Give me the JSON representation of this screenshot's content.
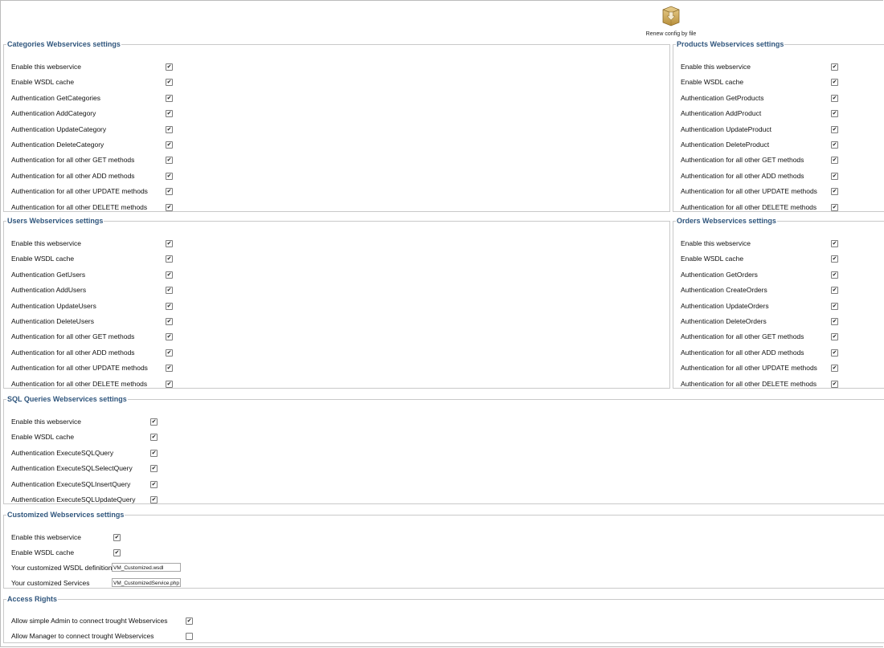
{
  "toolbar": {
    "renew_label": "Renew config by file",
    "renew_icon": "package-down-icon"
  },
  "categories": {
    "title": "Categories Webservices settings",
    "rows": [
      {
        "label": "Enable this webservice",
        "checked": true
      },
      {
        "label": "Enable WSDL cache",
        "checked": true
      },
      {
        "label": "Authentication GetCategories",
        "checked": true
      },
      {
        "label": "Authentication AddCategory",
        "checked": true
      },
      {
        "label": "Authentication UpdateCategory",
        "checked": true
      },
      {
        "label": "Authentication DeleteCategory",
        "checked": true
      },
      {
        "label": "Authentication for all other GET methods",
        "checked": true
      },
      {
        "label": "Authentication for all other ADD methods",
        "checked": true
      },
      {
        "label": "Authentication for all other UPDATE methods",
        "checked": true
      },
      {
        "label": "Authentication for all other DELETE methods",
        "checked": true
      }
    ]
  },
  "products": {
    "title": "Products Webservices settings",
    "rows": [
      {
        "label": "Enable this webservice",
        "checked": true
      },
      {
        "label": "Enable WSDL cache",
        "checked": true
      },
      {
        "label": "Authentication GetProducts",
        "checked": true
      },
      {
        "label": "Authentication AddProduct",
        "checked": true
      },
      {
        "label": "Authentication UpdateProduct",
        "checked": true
      },
      {
        "label": "Authentication DeleteProduct",
        "checked": true
      },
      {
        "label": "Authentication for all other GET methods",
        "checked": true
      },
      {
        "label": "Authentication for all other ADD methods",
        "checked": true
      },
      {
        "label": "Authentication for all other UPDATE methods",
        "checked": true
      },
      {
        "label": "Authentication for all other DELETE methods",
        "checked": true
      }
    ]
  },
  "users": {
    "title": "Users Webservices settings",
    "rows": [
      {
        "label": "Enable this webservice",
        "checked": true
      },
      {
        "label": "Enable WSDL cache",
        "checked": true
      },
      {
        "label": "Authentication GetUsers",
        "checked": true
      },
      {
        "label": "Authentication AddUsers",
        "checked": true
      },
      {
        "label": "Authentication UpdateUsers",
        "checked": true
      },
      {
        "label": "Authentication DeleteUsers",
        "checked": true
      },
      {
        "label": "Authentication for all other GET methods",
        "checked": true
      },
      {
        "label": "Authentication for all other ADD methods",
        "checked": true
      },
      {
        "label": "Authentication for all other UPDATE methods",
        "checked": true
      },
      {
        "label": "Authentication for all other DELETE methods",
        "checked": true
      }
    ]
  },
  "orders": {
    "title": "Orders Webservices settings",
    "rows": [
      {
        "label": "Enable this webservice",
        "checked": true
      },
      {
        "label": "Enable WSDL cache",
        "checked": true
      },
      {
        "label": "Authentication GetOrders",
        "checked": true
      },
      {
        "label": "Authentication CreateOrders",
        "checked": true
      },
      {
        "label": "Authentication UpdateOrders",
        "checked": true
      },
      {
        "label": "Authentication DeleteOrders",
        "checked": true
      },
      {
        "label": "Authentication for all other GET methods",
        "checked": true
      },
      {
        "label": "Authentication for all other ADD methods",
        "checked": true
      },
      {
        "label": "Authentication for all other UPDATE methods",
        "checked": true
      },
      {
        "label": "Authentication for all other DELETE methods",
        "checked": true
      }
    ]
  },
  "sql": {
    "title": "SQL Queries Webservices settings",
    "rows": [
      {
        "label": "Enable this webservice",
        "checked": true
      },
      {
        "label": "Enable WSDL cache",
        "checked": true
      },
      {
        "label": "Authentication ExecuteSQLQuery",
        "checked": true
      },
      {
        "label": "Authentication ExecuteSQLSelectQuery",
        "checked": true
      },
      {
        "label": "Authentication ExecuteSQLInsertQuery",
        "checked": true
      },
      {
        "label": "Authentication ExecuteSQLUpdateQuery",
        "checked": true
      }
    ]
  },
  "customized": {
    "title": "Customized Webservices settings",
    "rows": [
      {
        "label": "Enable this webservice",
        "checked": true
      },
      {
        "label": "Enable WSDL cache",
        "checked": true
      }
    ],
    "wsdl_label": "Your customized WSDL definition",
    "wsdl_value": "VM_Customized.wsdl",
    "services_label": "Your customized Services",
    "services_value": "VM_CustomizedService.php"
  },
  "access": {
    "title": "Access Rights",
    "rows": [
      {
        "label": "Allow simple Admin to connect trought Webservices",
        "checked": true
      },
      {
        "label": "Allow Manager to connect trought Webservices",
        "checked": false
      }
    ]
  }
}
